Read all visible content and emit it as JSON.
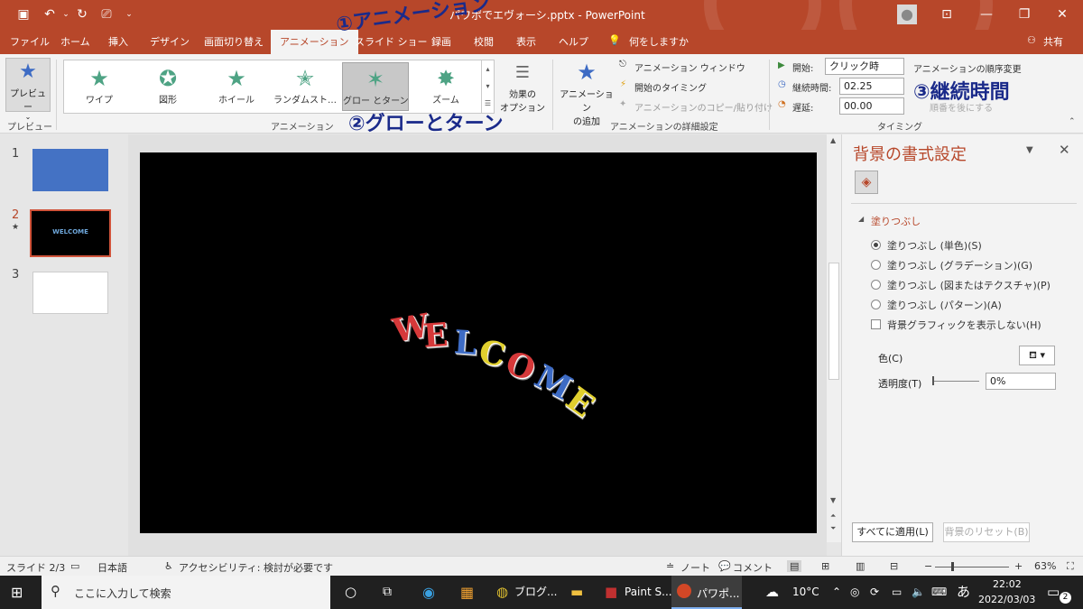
{
  "app": {
    "doc_title": "パワポでエヴォーシ.pptx - PowerPoint",
    "accent": "#b7472a"
  },
  "tabs": [
    {
      "label": "ファイル"
    },
    {
      "label": "ホーム"
    },
    {
      "label": "挿入"
    },
    {
      "label": "デザイン"
    },
    {
      "label": "画面切り替え"
    },
    {
      "label": "アニメーション"
    },
    {
      "label": "スライド ショー"
    },
    {
      "label": "録画"
    },
    {
      "label": "校閲"
    },
    {
      "label": "表示"
    },
    {
      "label": "ヘルプ"
    }
  ],
  "tell_me": "何をしますか",
  "share": "共有",
  "ribbon": {
    "preview": {
      "label": "プレビュー",
      "group": "プレビュー"
    },
    "gallery": [
      {
        "label": "ワイプ"
      },
      {
        "label": "図形"
      },
      {
        "label": "ホイール"
      },
      {
        "label": "ランダムスト…"
      },
      {
        "label": "グロー とターン"
      },
      {
        "label": "ズーム"
      }
    ],
    "effect_options": [
      "効果の",
      "オプション"
    ],
    "animation_group": "アニメーション",
    "add_animation": [
      "アニメーション",
      "の追加"
    ],
    "advanced": {
      "pane": "アニメーション ウィンドウ",
      "trigger": "開始のタイミング",
      "painter": "アニメーションのコピー/貼り付け",
      "group": "アニメーションの詳細設定"
    },
    "timing": {
      "start_label": "開始:",
      "start_value": "クリック時",
      "duration_label": "継続時間:",
      "duration_value": "02.25",
      "delay_label": "遅延:",
      "delay_value": "00.00",
      "reorder_title": "アニメーションの順序変更",
      "move_later": "順番を後にする",
      "group": "タイミング"
    }
  },
  "annotations": {
    "a1": "①アニメーション",
    "a2": "②グローとターン",
    "a3": "③継続時間"
  },
  "thumbnails": [
    {
      "num": "1"
    },
    {
      "num": "2",
      "text": "WELCOME"
    },
    {
      "num": "3"
    }
  ],
  "slide": {
    "letters": [
      {
        "ch": "W",
        "color": "#d6393a"
      },
      {
        "ch": "E",
        "color": "#d6393a"
      },
      {
        "ch": "L",
        "color": "#3d6bc4"
      },
      {
        "ch": "C",
        "color": "#e0cf2e"
      },
      {
        "ch": "O",
        "color": "#d6393a"
      },
      {
        "ch": "M",
        "color": "#3d6bc4"
      },
      {
        "ch": "E",
        "color": "#e0cf2e"
      }
    ]
  },
  "pane": {
    "title": "背景の書式設定",
    "section": "塗りつぶし",
    "options": [
      "塗りつぶし (単色)(S)",
      "塗りつぶし (グラデーション)(G)",
      "塗りつぶし (図またはテクスチャ)(P)",
      "塗りつぶし (パターン)(A)"
    ],
    "hide_graphics": "背景グラフィックを表示しない(H)",
    "color_label": "色(C)",
    "transparency_label": "透明度(T)",
    "transparency_value": "0%",
    "apply_all": "すべてに適用(L)",
    "reset": "背景のリセット(B)"
  },
  "status": {
    "slide": "スライド 2/3",
    "lang": "日本語",
    "accessibility": "アクセシビリティ: 検討が必要です",
    "notes": "ノート",
    "comments": "コメント",
    "zoom": "63%"
  },
  "taskbar": {
    "search": "ここに入力して検索",
    "apps": [
      "ブログ...",
      "Paint S...",
      "パワポ..."
    ],
    "weather": "10°C",
    "ime": "あ",
    "time": "22:02",
    "date": "2022/03/03",
    "notifications": "2"
  }
}
